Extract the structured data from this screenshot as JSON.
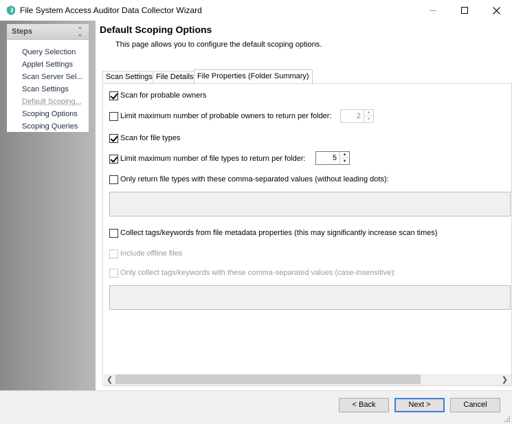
{
  "window": {
    "title": "File System Access Auditor Data Collector Wizard",
    "icon": "shield-logo-icon",
    "accent": "#3cb4a0"
  },
  "steps": {
    "title": "Steps",
    "items": [
      {
        "label": "Query Selection"
      },
      {
        "label": "Applet Settings"
      },
      {
        "label": "Scan Server Sel..."
      },
      {
        "label": "Scan Settings"
      },
      {
        "label": "Default Scoping..."
      },
      {
        "label": "Scoping Options"
      },
      {
        "label": "Scoping Queries"
      }
    ],
    "current_index": 4
  },
  "page": {
    "title": "Default Scoping Options",
    "description": "This page allows you to configure the default scoping options."
  },
  "tabs": [
    {
      "label": "Scan Settings"
    },
    {
      "label": "File Details"
    },
    {
      "label": "File Properties (Folder Summary)"
    }
  ],
  "active_tab": 2,
  "options": {
    "scan_owners": {
      "label": "Scan for probable owners",
      "checked": true
    },
    "limit_owners": {
      "label": "Limit maximum number of probable owners to return per folder:",
      "checked": false,
      "value": "2"
    },
    "scan_types": {
      "label": "Scan for file types",
      "checked": true
    },
    "limit_types": {
      "label": "Limit maximum number of file types to return per folder:",
      "checked": true,
      "value": "5"
    },
    "only_types": {
      "label": "Only return file types with these comma-separated values (without leading dots):",
      "checked": false,
      "value": ""
    },
    "collect_tags": {
      "label": "Collect tags/keywords from file metadata properties (this may significantly increase scan times)",
      "checked": false
    },
    "include_offline": {
      "label": "Include offline files",
      "checked": false
    },
    "only_tags": {
      "label": "Only collect tags/keywords with these comma-separated values (case-insensitive):",
      "checked": false,
      "value": ""
    }
  },
  "buttons": {
    "back": "< Back",
    "next": "Next >",
    "cancel": "Cancel"
  }
}
